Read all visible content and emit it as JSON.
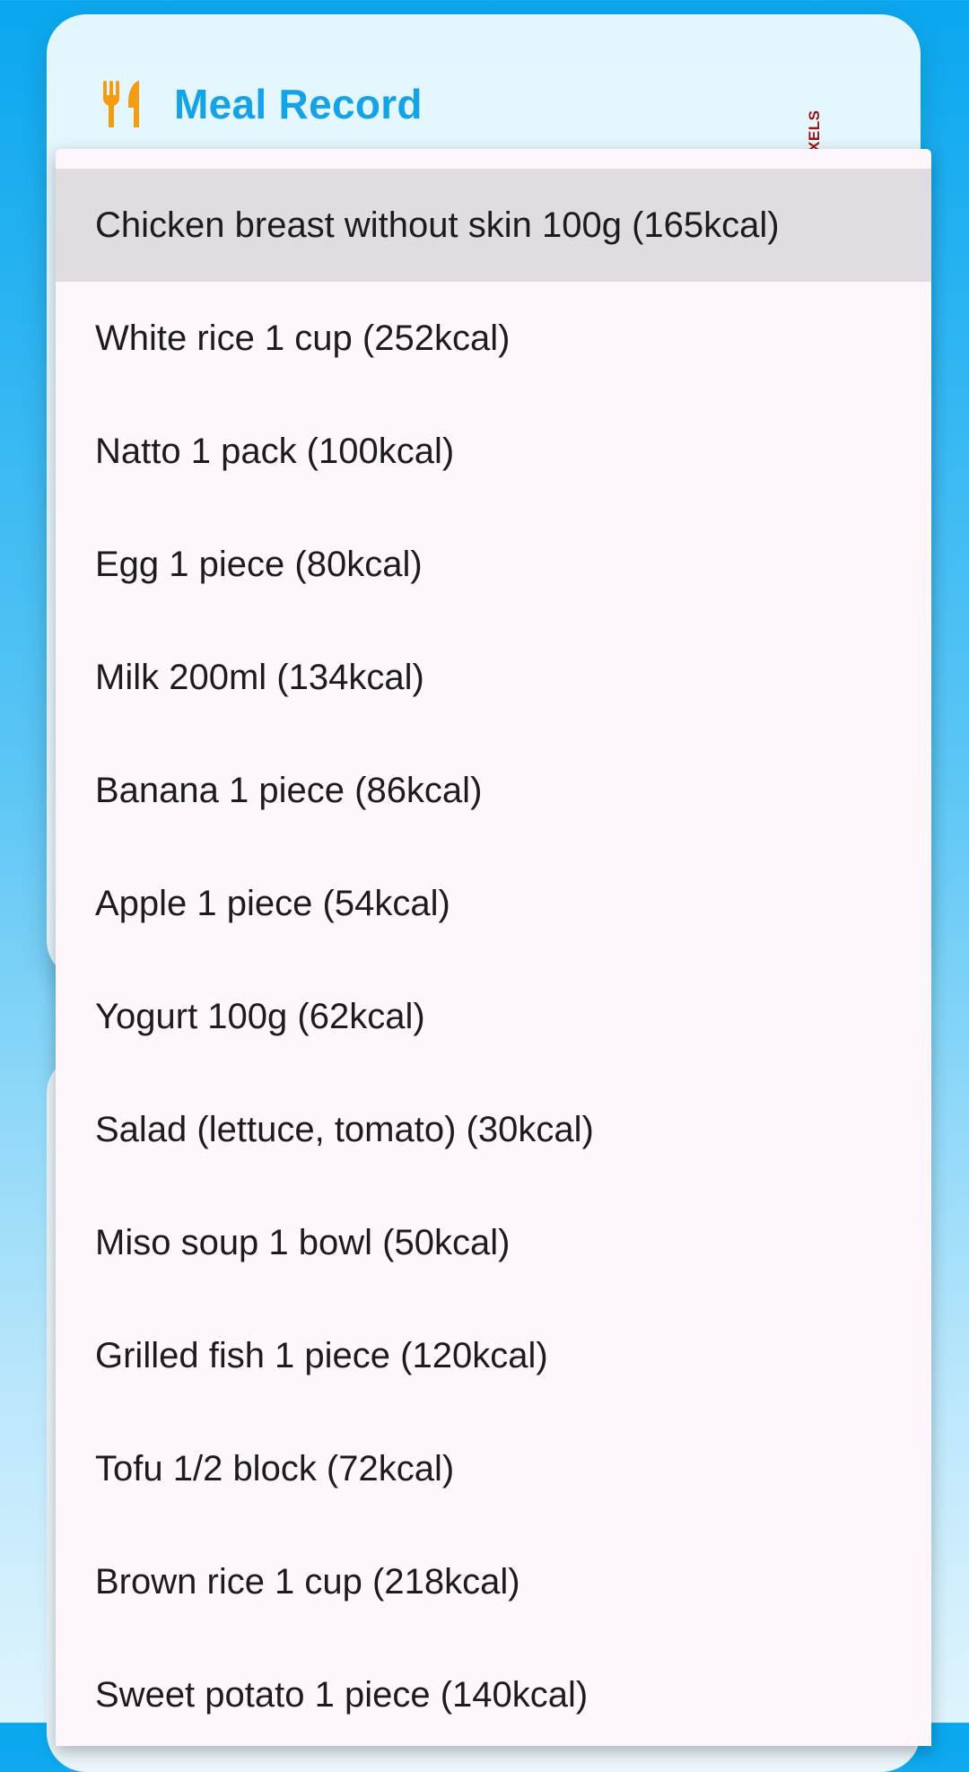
{
  "meal_card": {
    "title": "Meal Record",
    "icon": "fork-knife-icon",
    "accent_color": "#14a3e6",
    "icon_color": "#f59c13"
  },
  "debug_banner": {
    "text": "PIXELS"
  },
  "food_dropdown": {
    "selected_index": 0,
    "items": [
      {
        "label": "Chicken breast without skin 100g (165kcal)"
      },
      {
        "label": "White rice 1 cup (252kcal)"
      },
      {
        "label": "Natto 1 pack (100kcal)"
      },
      {
        "label": "Egg 1 piece (80kcal)"
      },
      {
        "label": "Milk 200ml (134kcal)"
      },
      {
        "label": "Banana 1 piece (86kcal)"
      },
      {
        "label": "Apple 1 piece (54kcal)"
      },
      {
        "label": "Yogurt 100g (62kcal)"
      },
      {
        "label": "Salad (lettuce, tomato) (30kcal)"
      },
      {
        "label": "Miso soup 1 bowl (50kcal)"
      },
      {
        "label": "Grilled fish 1 piece (120kcal)"
      },
      {
        "label": "Tofu 1/2 block (72kcal)"
      },
      {
        "label": "Brown rice 1 cup (218kcal)"
      },
      {
        "label": "Sweet potato 1 piece (140kcal)"
      }
    ]
  }
}
